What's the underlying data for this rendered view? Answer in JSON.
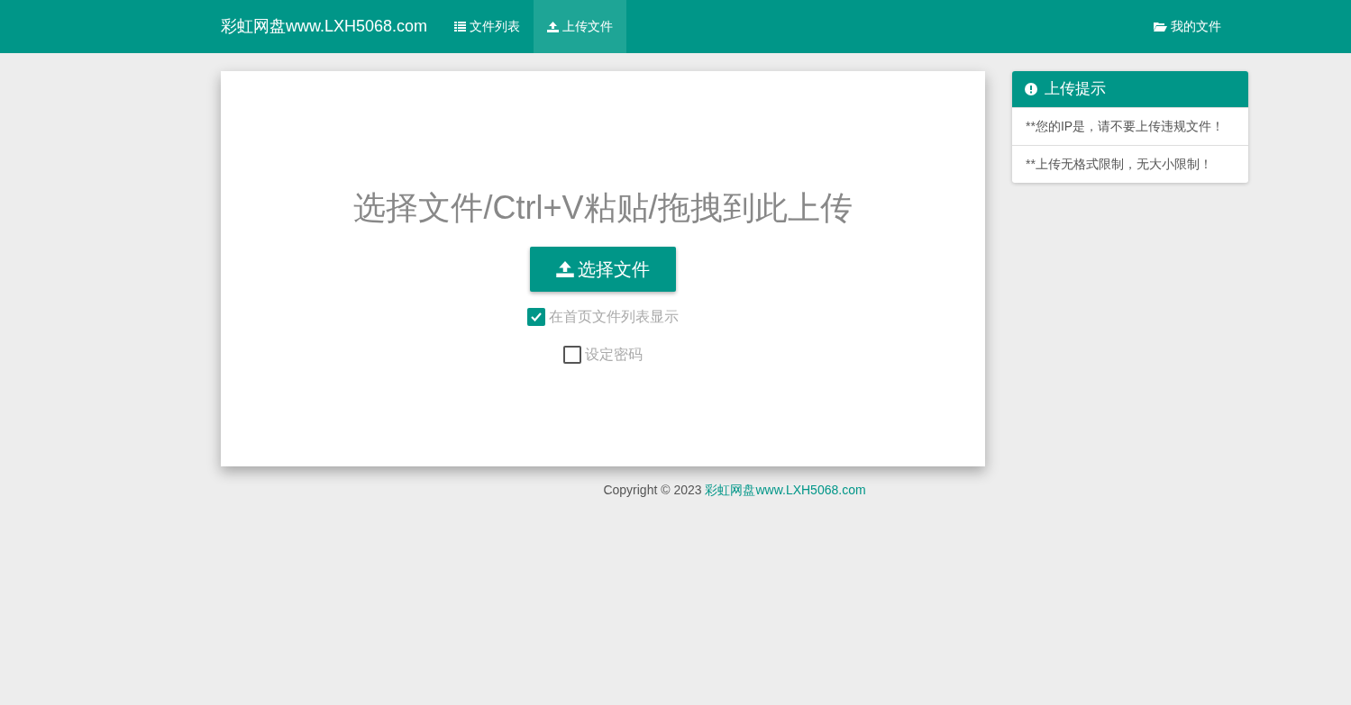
{
  "navbar": {
    "brand": "彩虹网盘www.LXH5068.com",
    "items": [
      {
        "label": "文件列表",
        "selected": false
      },
      {
        "label": "上传文件",
        "selected": true
      }
    ],
    "right_item": {
      "label": "我的文件"
    }
  },
  "upload": {
    "heading": "选择文件/Ctrl+V粘贴/拖拽到此上传",
    "button": "选择文件",
    "options": [
      {
        "label": "在首页文件列表显示",
        "checked": true
      },
      {
        "label": "设定密码",
        "checked": false
      }
    ]
  },
  "tips": {
    "title": "上传提示",
    "items": [
      "**您的IP是，请不要上传违规文件！",
      "**上传无格式限制，无大小限制！"
    ]
  },
  "footer": {
    "text": "Copyright © 2023",
    "link": "彩虹网盘www.LXH5068.com"
  }
}
